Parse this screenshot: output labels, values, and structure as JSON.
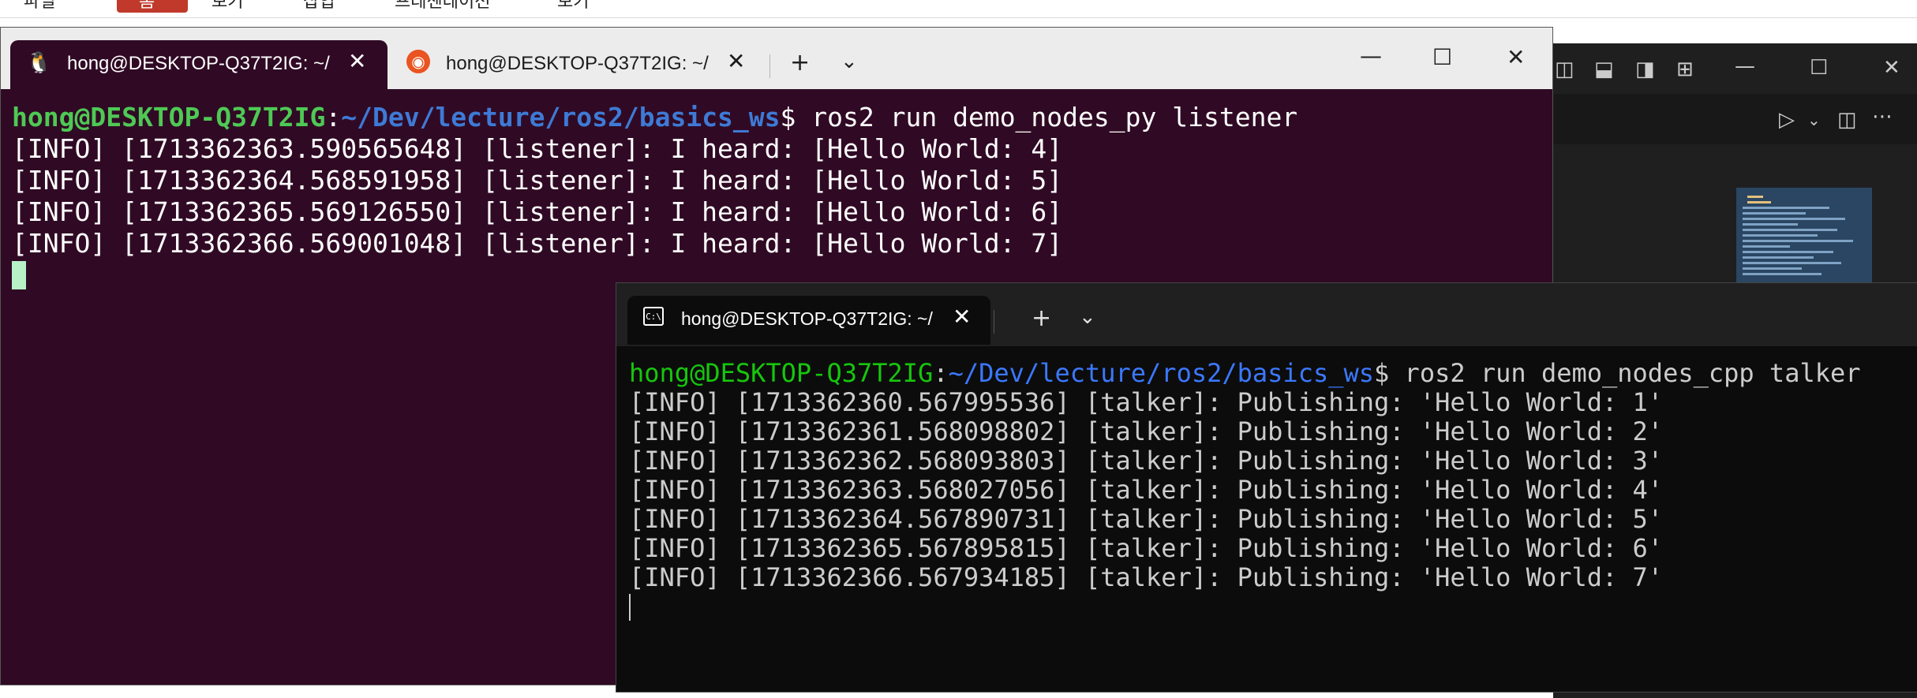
{
  "top_menu": {
    "items": [
      "파일",
      "홈",
      "보기",
      "삽입",
      "프레젠테이션",
      "보기"
    ]
  },
  "ubuntu_window": {
    "tabs": [
      {
        "label": "hong@DESKTOP-Q37T2IG: ~/",
        "icon": "linux-tux-icon",
        "active": true
      },
      {
        "label": "hong@DESKTOP-Q37T2IG: ~/",
        "icon": "ubuntu-icon",
        "active": false
      }
    ],
    "new_tab": "+",
    "dropdown": "⌄",
    "controls": {
      "minimize": "—",
      "maximize": "☐",
      "close": "✕"
    },
    "prompt": {
      "user": "hong@DESKTOP-Q37T2IG",
      "sep": ":",
      "path": "~/Dev/lecture/ros2/basics_ws",
      "symbol": "$ ",
      "command": "ros2 run demo_nodes_py listener"
    },
    "lines": [
      "[INFO] [1713362363.590565648] [listener]: I heard: [Hello World: 4]",
      "[INFO] [1713362364.568591958] [listener]: I heard: [Hello World: 5]",
      "[INFO] [1713362365.569126550] [listener]: I heard: [Hello World: 6]",
      "[INFO] [1713362366.569001048] [listener]: I heard: [Hello World: 7]"
    ]
  },
  "cmd_window": {
    "tabs": [
      {
        "label": "hong@DESKTOP-Q37T2IG: ~/",
        "icon": "cmd-icon",
        "active": true
      }
    ],
    "new_tab": "+",
    "dropdown": "⌄",
    "prompt": {
      "user": "hong@DESKTOP-Q37T2IG",
      "sep": ":",
      "path": "~/Dev/lecture/ros2/basics_ws",
      "symbol": "$ ",
      "command": "ros2 run demo_nodes_cpp talker"
    },
    "lines": [
      "[INFO] [1713362360.567995536] [talker]: Publishing: 'Hello World: 1'",
      "[INFO] [1713362361.568098802] [talker]: Publishing: 'Hello World: 2'",
      "[INFO] [1713362362.568093803] [talker]: Publishing: 'Hello World: 3'",
      "[INFO] [1713362363.568027056] [talker]: Publishing: 'Hello World: 4'",
      "[INFO] [1713362364.567890731] [talker]: Publishing: 'Hello World: 5'",
      "[INFO] [1713362365.567895815] [talker]: Publishing: 'Hello World: 6'",
      "[INFO] [1713362366.567934185] [talker]: Publishing: 'Hello World: 7'"
    ]
  },
  "vscode_window": {
    "controls": {
      "minimize": "—",
      "maximize": "☐",
      "close": "✕"
    }
  },
  "colors": {
    "ubuntu_bg": "#300a24",
    "cmd_bg": "#0c0c0c",
    "prompt_user_ubuntu": "#4ec955",
    "prompt_path_ubuntu": "#3e7ad6",
    "prompt_user_cmd": "#16c60c",
    "prompt_path_cmd": "#3b78ff"
  }
}
